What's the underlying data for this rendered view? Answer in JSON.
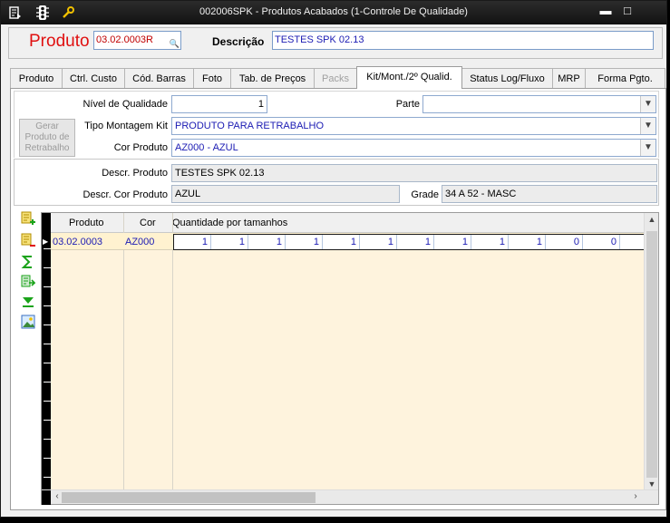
{
  "window": {
    "title": "002006SPK - Produtos Acabados (1-Controle De Qualidade)",
    "minimize_glyph": "▬",
    "maximize_glyph": "□"
  },
  "header": {
    "produto_label": "Produto",
    "produto_value": "03.02.0003R",
    "descricao_label": "Descrição",
    "descricao_value": "TESTES SPK 02.13"
  },
  "tabs": [
    {
      "label": "Produto"
    },
    {
      "label": "Ctrl. Custo"
    },
    {
      "label": "Cód. Barras"
    },
    {
      "label": "Foto"
    },
    {
      "label": "Tab. de Preços"
    },
    {
      "label": "Packs"
    },
    {
      "label": "Kit/Mont./2º Qualid."
    },
    {
      "label": "Status Log/Fluxo"
    },
    {
      "label": "MRP"
    },
    {
      "label": "Forma Pgto."
    }
  ],
  "form": {
    "nivel_label": "Nível de Qualidade",
    "nivel_value": "1",
    "parte_label": "Parte",
    "parte_value": "",
    "tipo_label": "Tipo Montagem Kit",
    "tipo_value": "PRODUTO PARA RETRABALHO",
    "cor_label": "Cor Produto",
    "cor_value": "AZ000 - AZUL",
    "gerar_button": "Gerar Produto de Retrabalho",
    "descr_label": "Descr. Produto",
    "descr_value": "TESTES SPK 02.13",
    "descr_cor_label": "Descr. Cor Produto",
    "descr_cor_value": "AZUL",
    "grade_label": "Grade",
    "grade_value": "34 A 52 - MASC"
  },
  "grid": {
    "headers": [
      "Produto",
      "Cor",
      "Quantidade por tamanhos"
    ],
    "rows": [
      {
        "produto": "03.02.0003",
        "cor": "AZ000",
        "qty": [
          "1",
          "1",
          "1",
          "1",
          "1",
          "1",
          "1",
          "1",
          "1",
          "1",
          "0",
          "0"
        ]
      }
    ]
  },
  "colors": {
    "titlebar": "#1a1a1a",
    "produto_label": "#e01010",
    "value_text": "#1b1bb3",
    "grid_body": "#fef3dd"
  }
}
